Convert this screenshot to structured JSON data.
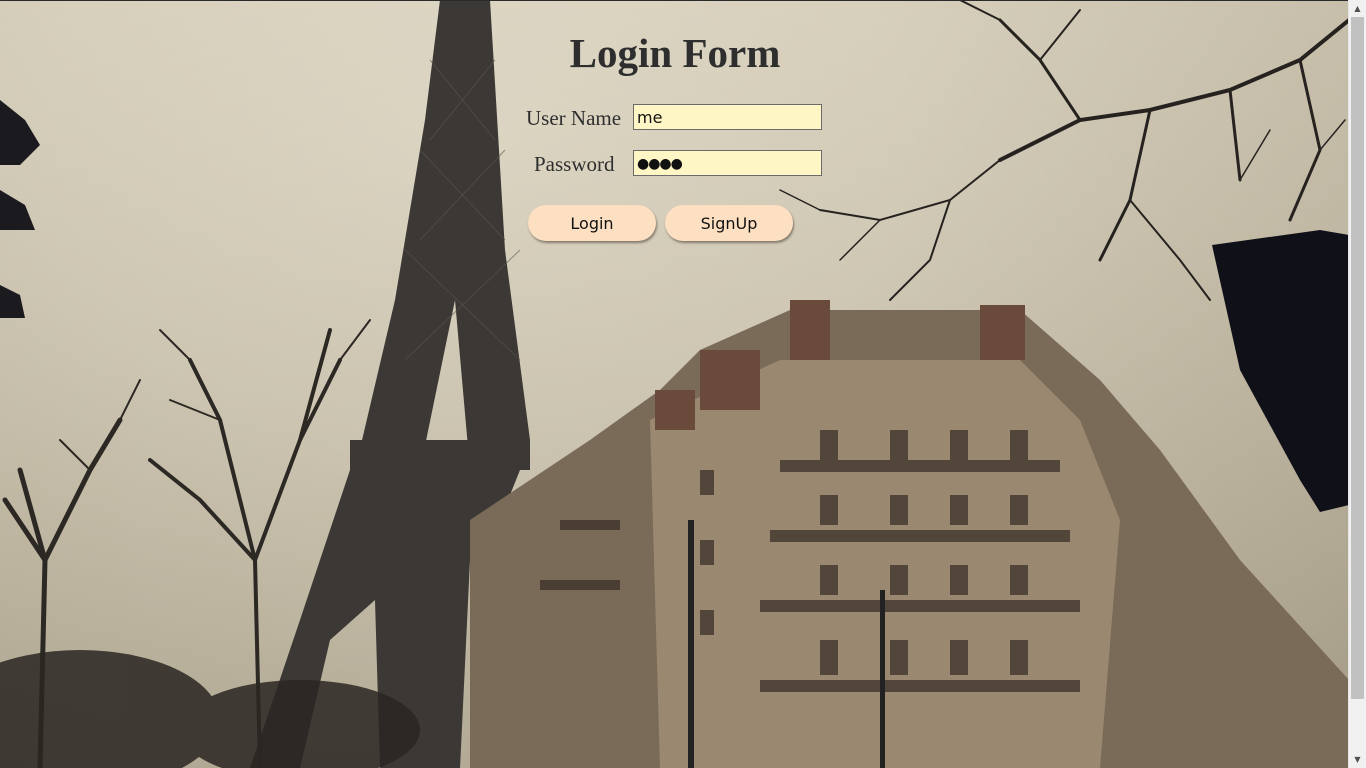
{
  "form": {
    "title": "Login Form",
    "username_label": "User Name",
    "username_value": "me",
    "password_label": "Password",
    "password_mask": "●●●●",
    "login_label": "Login",
    "signup_label": "SignUp"
  },
  "colors": {
    "input_bg": "#fff6c6",
    "button_bg": "#fde0c2",
    "text": "#2e2e2e"
  }
}
